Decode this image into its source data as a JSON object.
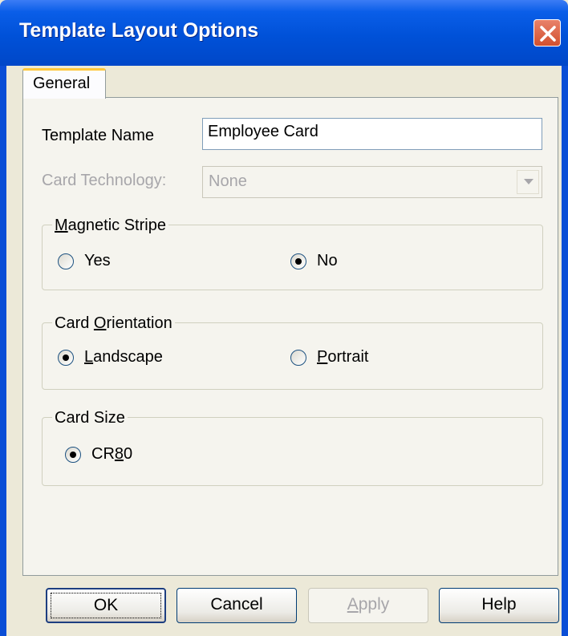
{
  "window": {
    "title": "Template Layout Options"
  },
  "tabs": [
    {
      "label": "General"
    }
  ],
  "form": {
    "template_name_label": "Template Name",
    "template_name_value": "Employee Card",
    "card_technology_label": "Card Technology:",
    "card_technology_value": "None"
  },
  "magnetic_stripe": {
    "title": "Magnetic Stripe",
    "options": [
      {
        "label": "Yes",
        "selected": false
      },
      {
        "label": "No",
        "selected": true
      }
    ]
  },
  "card_orientation": {
    "title": "Card Orientation",
    "options": [
      {
        "label": "Landscape",
        "selected": true
      },
      {
        "label": "Portrait",
        "selected": false
      }
    ]
  },
  "card_size": {
    "title": "Card Size",
    "options": [
      {
        "label": "CR80",
        "selected": true
      }
    ]
  },
  "buttons": {
    "ok": "OK",
    "cancel": "Cancel",
    "apply": "Apply",
    "help": "Help"
  },
  "icons": {
    "close": "close-icon",
    "dropdown": "chevron-down-icon"
  },
  "colors": {
    "titlebar": "#0a5ee8",
    "close_button": "#d2502f",
    "tab_highlight": "#ffc83c"
  }
}
